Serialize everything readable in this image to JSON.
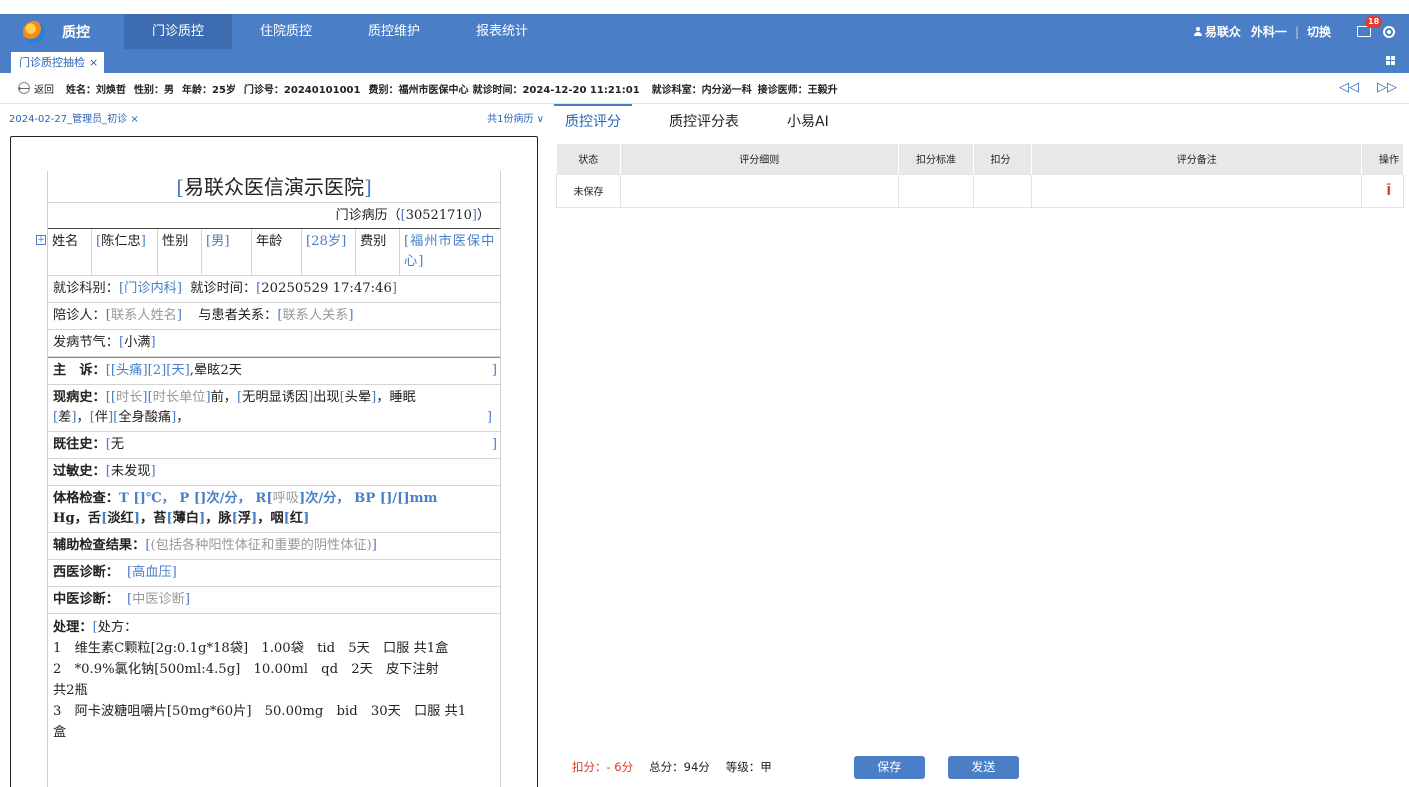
{
  "topbar": {
    "app_title": "质控",
    "nav": [
      "门诊质控",
      "住院质控",
      "质控维护",
      "报表统计"
    ],
    "user": "易联众",
    "dept": "外科一",
    "switch": "切换",
    "badge": "18"
  },
  "tabs": {
    "active_tab": "门诊质控抽检",
    "close": "×"
  },
  "patient_bar": {
    "back": "返回",
    "fields": [
      "姓名：刘焕哲",
      "性别：男",
      "年龄：25岁",
      "门诊号：20240101001",
      "费别：福州市医保中心",
      "就诊时间：2024-12-20 11:21:01",
      "就诊科室：内分泌一科",
      "接诊医师：王毅升"
    ]
  },
  "record_list": {
    "tab": "2024-02-27_管理员_初诊",
    "tab_close": "×",
    "count": "共1份病历 ∨"
  },
  "record": {
    "hospital": "易联众医信演示医院",
    "type_prefix": "门诊病历（",
    "record_no": "30521710",
    "type_suffix": "）",
    "patient": {
      "name_label": "姓名",
      "name": "陈仁忠",
      "sex_label": "性别",
      "sex": "男",
      "age_label": "年龄",
      "age": "28岁",
      "fee_label": "费别",
      "fee": "福州市医保中心"
    },
    "visit": {
      "dept_label": "就诊科别：",
      "dept": "门诊内科",
      "time_label": "就诊时间：",
      "time": "20250529 17:47:46"
    },
    "companion": {
      "label": "陪诊人：",
      "name": "联系人姓名",
      "rel_label": "与患者关系：",
      "rel": "联系人关系"
    },
    "solar_term": {
      "label": "发病节气：",
      "value": "小满"
    },
    "complaint": {
      "label": "主　诉：",
      "prefix": "[",
      "s1": "头痛",
      "s2": "2",
      "s3": "天",
      "rest": ",晕眩2天"
    },
    "present": {
      "label": "现病史：",
      "t1": "时长",
      "t2": "时长单位",
      "p1": "前，",
      "t3": "无明显诱因",
      "p2": "出现",
      "t4": "头晕",
      "p3": "，睡眠",
      "t5": "差",
      "p4": "，",
      "t6": "伴",
      "t7": "全身酸痛",
      "p5": "，"
    },
    "past": {
      "label": "既往史：",
      "value": "无"
    },
    "allergy": {
      "label": "过敏史：",
      "value": "未发现"
    },
    "exam": {
      "label": "体格检查：",
      "line1": "T []℃， P []次/分， R",
      "resp": "呼吸",
      "line2": "次/分， BP []/[]mm",
      "line3a": "Hg，舌",
      "tongue": "淡红",
      "line3b": "，苔",
      "coat": "薄白",
      "line3c": "，脉",
      "pulse": "浮",
      "line3d": "，咽",
      "throat": "红"
    },
    "aux": {
      "label": "辅助检查结果：",
      "value": "(包括各种阳性体征和重要的阴性体征)"
    },
    "west": {
      "label": "西医诊断：",
      "value": "高血压"
    },
    "tcm": {
      "label": "中医诊断：",
      "value": "中医诊断"
    },
    "treatment": {
      "label": "处理：",
      "head": "处方：",
      "l1": "1　维生素C颗粒[2g:0.1g*18袋]　1.00袋　tid　5天　口服 共1盒",
      "l2": "2　*0.9%氯化钠[500ml:4.5g]　10.00ml　qd　2天　皮下注射",
      "l3": "共2瓶",
      "l4": "3　阿卡波糖咀嚼片[50mg*60片]　50.00mg　bid　30天　口服 共1",
      "l5": "盒"
    }
  },
  "qc": {
    "tabs": [
      "质控评分",
      "质控评分表",
      "小易AI"
    ],
    "columns": [
      "状态",
      "评分细则",
      "扣分标准",
      "扣分",
      "评分备注",
      "操作"
    ],
    "rows": [
      {
        "status": "未保存",
        "rule": "",
        "standard": "",
        "deduct": "",
        "remark": ""
      }
    ],
    "deduct_text": "扣分：- 6分",
    "total_text": "总分：94分",
    "level_text": "等级：甲",
    "save": "保存",
    "send": "发送"
  },
  "colors": {
    "primary": "#4a7fc8",
    "danger": "#d9372a"
  }
}
